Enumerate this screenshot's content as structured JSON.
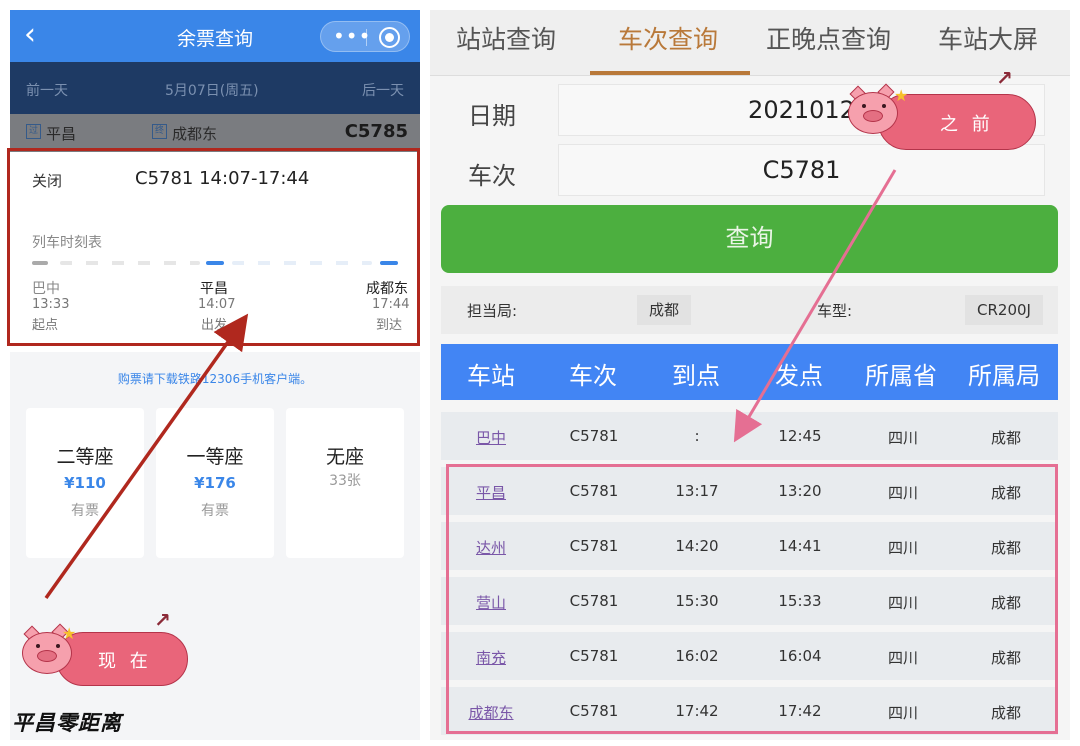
{
  "left": {
    "header": {
      "back_icon": "chevron-left-icon",
      "title": "余票查询",
      "more_icon": "more-dots-icon",
      "target_icon": "target-icon"
    },
    "datebar": {
      "prev": "前一天",
      "date": "5月07日(周五)",
      "next": "后一天"
    },
    "stations": {
      "from_tag": "过",
      "from": "平昌",
      "to_tag": "终",
      "to": "成都东",
      "train_code": "C5785"
    },
    "card": {
      "close": "关闭",
      "train_info": "C5781 14:07-17:44",
      "schedule_label": "列车时刻表",
      "stops": [
        {
          "name": "巴中",
          "time": "13:33",
          "kind": "起点"
        },
        {
          "name": "平昌",
          "time": "14:07",
          "kind": "出发"
        },
        {
          "name": "成都东",
          "time": "17:44",
          "kind": "到达"
        }
      ]
    },
    "note": "购票请下载铁路12306手机客户端。",
    "seats": [
      {
        "name": "二等座",
        "price": "¥110",
        "avail": "有票"
      },
      {
        "name": "一等座",
        "price": "¥176",
        "avail": "有票"
      },
      {
        "name": "无座",
        "price": "",
        "avail": "33张"
      }
    ],
    "sticker": "现 在"
  },
  "right": {
    "tabs": [
      "站站查询",
      "车次查询",
      "正晚点查询",
      "车站大屏"
    ],
    "active_tab": "车次查询",
    "date_label": "日期",
    "date_value": "2021012",
    "train_label": "车次",
    "train_value": "C5781",
    "query_button": "查询",
    "info": {
      "bureau_label": "担当局:",
      "bureau_value": "成都",
      "model_label": "车型:",
      "model_value": "CR200J"
    },
    "table": {
      "headers": [
        "车站",
        "车次",
        "到点",
        "发点",
        "所属省",
        "所属局"
      ],
      "rows": [
        {
          "station": "巴中",
          "train": "C5781",
          "arrive": ":",
          "depart": "12:45",
          "province": "四川",
          "bureau": "成都"
        },
        {
          "station": "平昌",
          "train": "C5781",
          "arrive": "13:17",
          "depart": "13:20",
          "province": "四川",
          "bureau": "成都"
        },
        {
          "station": "达州",
          "train": "C5781",
          "arrive": "14:20",
          "depart": "14:41",
          "province": "四川",
          "bureau": "成都"
        },
        {
          "station": "营山",
          "train": "C5781",
          "arrive": "15:30",
          "depart": "15:33",
          "province": "四川",
          "bureau": "成都"
        },
        {
          "station": "南充",
          "train": "C5781",
          "arrive": "16:02",
          "depart": "16:04",
          "province": "四川",
          "bureau": "成都"
        },
        {
          "station": "成都东",
          "train": "C5781",
          "arrive": "17:42",
          "depart": "17:42",
          "province": "四川",
          "bureau": "成都"
        }
      ]
    },
    "sticker": "之 前"
  },
  "brand": "平昌零距离",
  "colors": {
    "header_blue": "#3a86e8",
    "green_button": "#4caf3f",
    "table_head": "#4285f4",
    "active_tab": "#b9793a",
    "red_highlight": "#b0281e",
    "pink_highlight": "#e56f93"
  }
}
